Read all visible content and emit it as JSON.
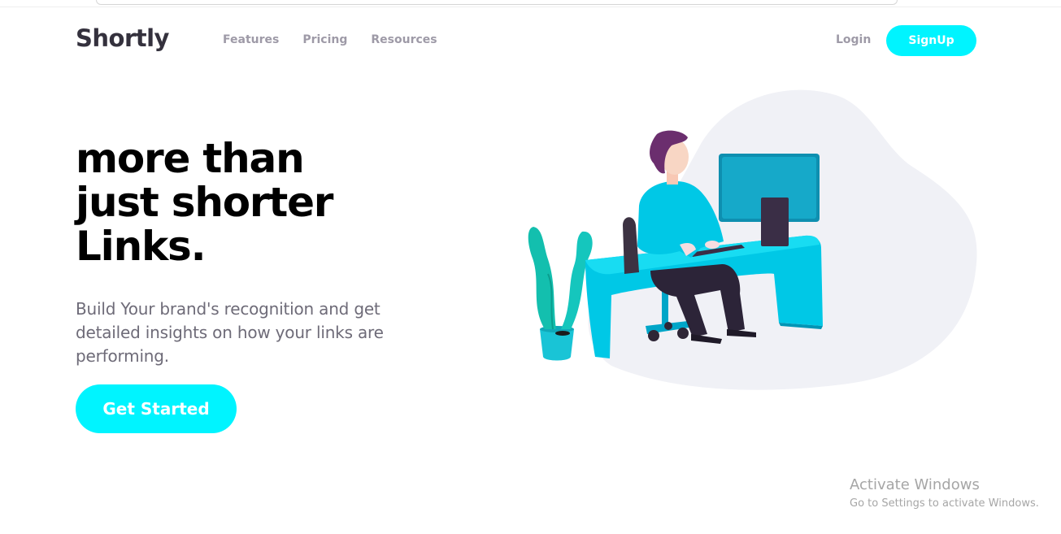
{
  "header": {
    "logo": "Shortly",
    "nav": [
      {
        "label": "Features"
      },
      {
        "label": "Pricing"
      },
      {
        "label": "Resources"
      }
    ],
    "login_label": "Login",
    "signup_label": "SignUp"
  },
  "hero": {
    "title_lines": [
      "more than",
      "just shorter",
      "Links."
    ],
    "description": "Build Your brand's recognition and get detailed insights on how your links are performing.",
    "cta_label": "Get Started",
    "illustration": "person-working-at-desk-illustration"
  },
  "watermark": {
    "title": "Activate Windows",
    "subtitle": "Go to Settings to activate Windows."
  },
  "colors": {
    "accent": "#00f4ff",
    "text_dark": "#34313d",
    "nav_text": "#9e9aa7",
    "body_text": "#6e6b78",
    "blob": "#f0f1f6"
  }
}
